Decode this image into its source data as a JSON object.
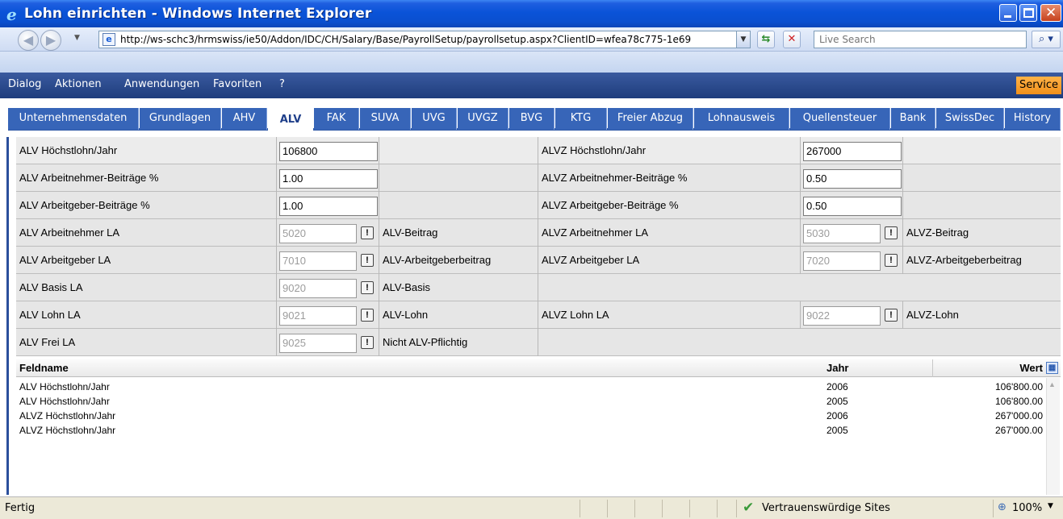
{
  "window": {
    "title": "Lohn einrichten - Windows Internet Explorer"
  },
  "browser": {
    "url": "http://ws-schc3/hrmswiss/ie50/Addon/IDC/CH/Salary/Base/PayrollSetup/payrollsetup.aspx?ClientID=wfea78c775-1e69",
    "search_placeholder": "Live Search",
    "status_text": "Fertig",
    "zone_text": "Vertrauenswürdige Sites",
    "zoom_text": "100%"
  },
  "menu": {
    "items": [
      "Dialog",
      "Aktionen",
      "Anwendungen",
      "Favoriten",
      "?"
    ],
    "service_label": "Service"
  },
  "tabs": {
    "items": [
      "Unternehmensdaten",
      "Grundlagen",
      "AHV",
      "ALV",
      "FAK",
      "SUVA",
      "UVG",
      "UVGZ",
      "BVG",
      "KTG",
      "Freier Abzug",
      "Lohnausweis",
      "Quellensteuer",
      "Bank",
      "SwissDec",
      "History"
    ],
    "active": "ALV"
  },
  "form": {
    "rows": [
      {
        "left_label": "ALV Höchstlohn/Jahr",
        "left_value": "106800",
        "left_desc": "",
        "right_label": "ALVZ Höchstlohn/Jahr",
        "right_value": "267000",
        "right_desc": ""
      },
      {
        "left_label": "ALV Arbeitnehmer-Beiträge %",
        "left_value": "1.00",
        "left_desc": "",
        "right_label": "ALVZ Arbeitnehmer-Beiträge %",
        "right_value": "0.50",
        "right_desc": ""
      },
      {
        "left_label": "ALV Arbeitgeber-Beiträge %",
        "left_value": "1.00",
        "left_desc": "",
        "right_label": "ALVZ Arbeitgeber-Beiträge %",
        "right_value": "0.50",
        "right_desc": ""
      },
      {
        "left_label": "ALV Arbeitnehmer LA",
        "left_value": "5020",
        "left_desc": "ALV-Beitrag",
        "right_label": "ALVZ Arbeitnehmer LA",
        "right_value": "5030",
        "right_desc": "ALVZ-Beitrag"
      },
      {
        "left_label": "ALV Arbeitgeber LA",
        "left_value": "7010",
        "left_desc": "ALV-Arbeitgeberbeitrag",
        "right_label": "ALVZ Arbeitgeber LA",
        "right_value": "7020",
        "right_desc": "ALVZ-Arbeitgeberbeitrag"
      },
      {
        "left_label": "ALV Basis LA",
        "left_value": "9020",
        "left_desc": "ALV-Basis",
        "right_label": "",
        "right_value": "",
        "right_desc": ""
      },
      {
        "left_label": "ALV Lohn LA",
        "left_value": "9021",
        "left_desc": "ALV-Lohn",
        "right_label": "ALVZ Lohn LA",
        "right_value": "9022",
        "right_desc": "ALVZ-Lohn"
      },
      {
        "left_label": "ALV Frei LA",
        "left_value": "9025",
        "left_desc": "Nicht ALV-Pflichtig",
        "right_label": "",
        "right_value": "",
        "right_desc": ""
      }
    ]
  },
  "grid": {
    "headers": {
      "feldname": "Feldname",
      "jahr": "Jahr",
      "wert": "Wert"
    },
    "rows": [
      {
        "feldname": "ALV Höchstlohn/Jahr",
        "jahr": "2006",
        "wert": "106'800.00"
      },
      {
        "feldname": "ALV Höchstlohn/Jahr",
        "jahr": "2005",
        "wert": "106'800.00"
      },
      {
        "feldname": "ALVZ Höchstlohn/Jahr",
        "jahr": "2006",
        "wert": "267'000.00"
      },
      {
        "feldname": "ALVZ Höchstlohn/Jahr",
        "jahr": "2005",
        "wert": "267'000.00"
      }
    ]
  },
  "colors": {
    "title_bar": "#0a53d8",
    "menu_bar": "#2b4a8f",
    "tab": "#3765b8",
    "service": "#f0901a"
  }
}
